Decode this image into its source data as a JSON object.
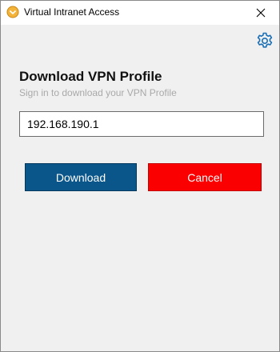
{
  "window": {
    "title": "Virtual Intranet Access",
    "app_icon": "vpn-app-icon",
    "close_icon": "close-icon",
    "settings_icon": "gear-icon"
  },
  "dialog": {
    "heading": "Download VPN Profile",
    "subheading": "Sign in to download your VPN Profile",
    "server_input_value": "192.168.190.1",
    "download_label": "Download",
    "cancel_label": "Cancel"
  },
  "colors": {
    "download_button": "#0a568a",
    "cancel_button": "#fb0000",
    "accent_icon": "#e8a020",
    "gear_icon": "#1a6fb5"
  }
}
